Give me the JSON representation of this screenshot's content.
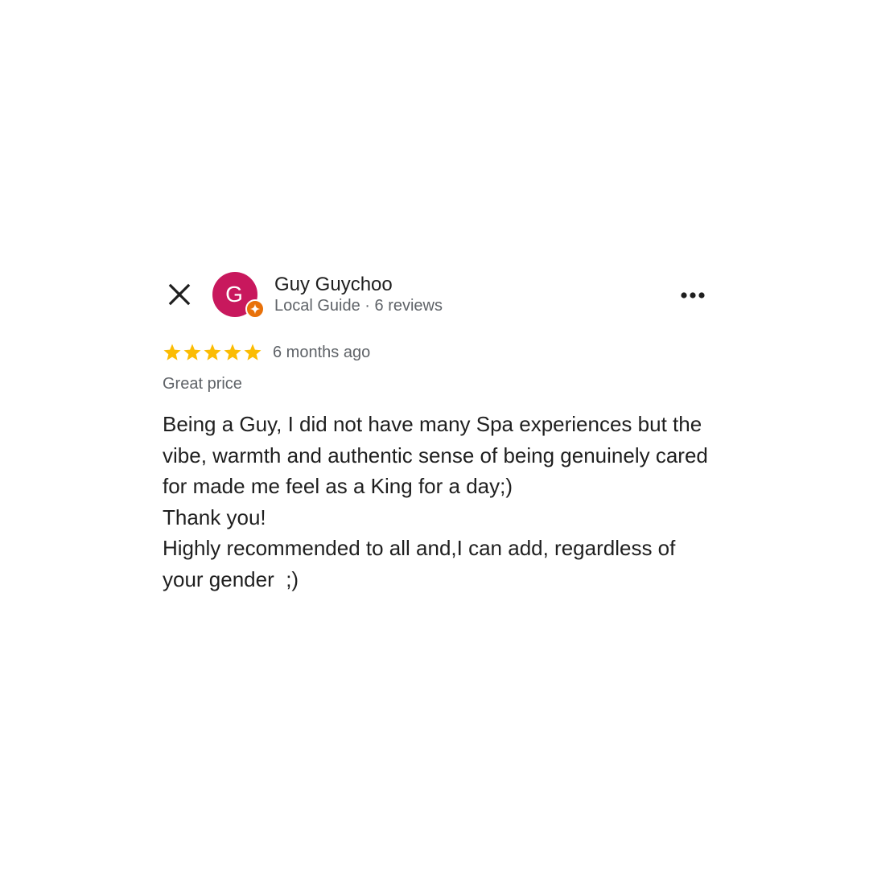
{
  "review": {
    "reviewer": {
      "initial": "G",
      "name": "Guy Guychoo",
      "meta": "Local Guide · 6 reviews",
      "avatar_color": "#c8185d",
      "badge_color": "#e8710a",
      "badge_icon": "local-guide-star-icon"
    },
    "rating": {
      "stars": 5,
      "max": 5,
      "star_color": "#fbbc04"
    },
    "date": "6 months ago",
    "tag": "Great price",
    "text": "Being a Guy, I did not have many Spa experiences but the vibe, warmth and authentic sense of being genuinely cared for made me feel as a King for a day;)\nThank you!\nHighly recommended to all and,I can add, regardless of your gender  ;)"
  },
  "controls": {
    "close_icon": "close-icon",
    "more_icon": "more-horizontal-icon"
  }
}
